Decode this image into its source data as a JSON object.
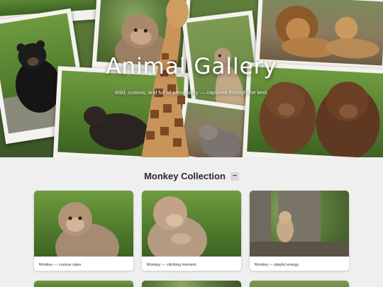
{
  "hero": {
    "title": "Animal Gallery",
    "subtitle": "Wild, curious, and full of personality — captured through the lens."
  },
  "collection": {
    "title": "Monkey Collection",
    "toggle_label": "−",
    "cards": [
      {
        "caption": "Monkey — curious stare"
      },
      {
        "caption": "Monkey — climbing moment"
      },
      {
        "caption": "Monkey — playful energy"
      }
    ]
  },
  "colors": {
    "page_background": "#efefef",
    "card_background": "#ffffff",
    "polaroid_frame": "#f4f2ee",
    "hero_text": "#ffffff"
  }
}
